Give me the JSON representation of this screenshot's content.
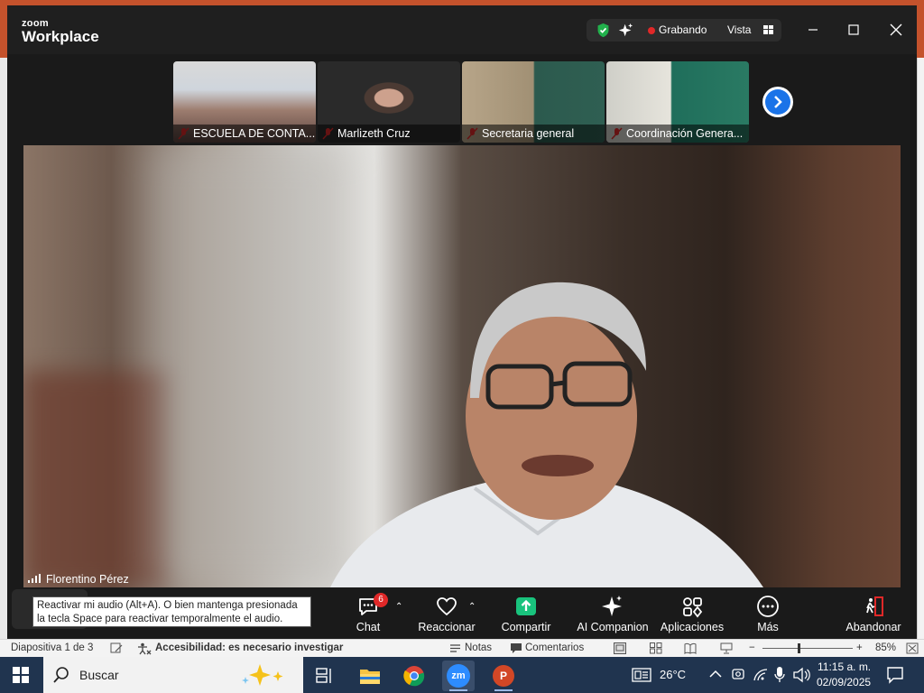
{
  "zoom": {
    "brand_top": "zoom",
    "brand_bottom": "Workplace",
    "recording_label": "Grabando",
    "view_label": "Vista",
    "thumbnails": [
      {
        "name": "ESCUELA DE CONTA..."
      },
      {
        "name": "Marlizeth Cruz"
      },
      {
        "name": "Secretaria general"
      },
      {
        "name": "Coordinación Genera..."
      }
    ],
    "active_speaker": "Florentino Pérez",
    "tooltip": "Reactivar mi audio (Alt+A). O bien mantenga presionada la tecla Space para reactivar temporalmente el audio.",
    "toolbar": {
      "chat_label": "Chat",
      "chat_badge": "6",
      "react_label": "Reaccionar",
      "share_label": "Compartir",
      "ai_label": "AI Companion",
      "apps_label": "Aplicaciones",
      "more_label": "Más",
      "leave_label": "Abandonar"
    },
    "colors": {
      "record": "#e02828",
      "share": "#19c37d",
      "leave": "#e02828",
      "shield": "#22b14c"
    }
  },
  "powerpoint": {
    "slide_info": "Diapositiva 1 de 3",
    "accessibility": "Accesibilidad: es necesario investigar",
    "notes": "Notas",
    "comments": "Comentarios",
    "zoom_level": "85%",
    "zoom_minus": "−",
    "zoom_plus": "+"
  },
  "taskbar": {
    "search_label": "Buscar",
    "zoom_app_label": "zm",
    "ppt_app_label": "P",
    "temperature": "26°C",
    "time": "11:15 a. m.",
    "date": "02/09/2025"
  }
}
